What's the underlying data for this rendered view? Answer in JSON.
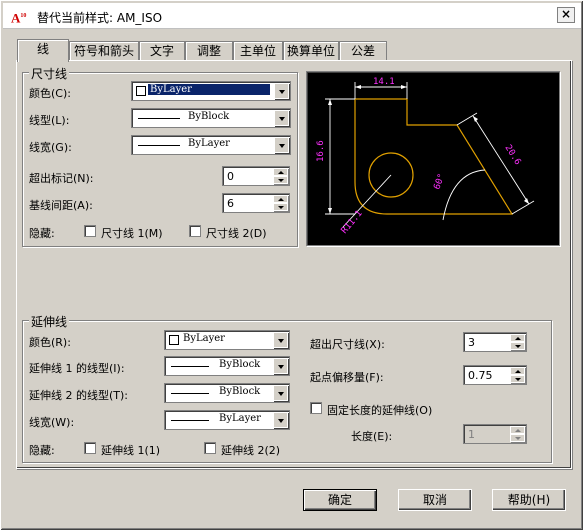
{
  "window": {
    "title": "替代当前样式: AM_ISO",
    "close_label": "×"
  },
  "tabs": [
    {
      "label": "线"
    },
    {
      "label": "符号和箭头"
    },
    {
      "label": "文字"
    },
    {
      "label": "调整"
    },
    {
      "label": "主单位"
    },
    {
      "label": "换算单位"
    },
    {
      "label": "公差"
    }
  ],
  "dim_lines": {
    "legend": "尺寸线",
    "color_label": "颜色(C):",
    "color_value": "ByLayer",
    "linetype_label": "线型(L):",
    "linetype_value": "ByBlock",
    "lineweight_label": "线宽(G):",
    "lineweight_value": "ByLayer",
    "extend_label": "超出标记(N):",
    "extend_value": "0",
    "baseline_label": "基线间距(A):",
    "baseline_value": "6",
    "suppress_label": "隐藏:",
    "suppress1_label": "尺寸线 1(M)",
    "suppress2_label": "尺寸线 2(D)"
  },
  "preview": {
    "dims": [
      "14.1",
      "16.6",
      "20.6",
      "R11.1",
      "60°"
    ]
  },
  "ext_lines": {
    "legend": "延伸线",
    "color_label": "颜色(R):",
    "color_value": "ByLayer",
    "lt1_label": "延伸线 1 的线型(I):",
    "lt1_value": "ByBlock",
    "lt2_label": "延伸线 2 的线型(T):",
    "lt2_value": "ByBlock",
    "lw_label": "线宽(W):",
    "lw_value": "ByLayer",
    "suppress_label": "隐藏:",
    "suppress1_label": "延伸线 1(1)",
    "suppress2_label": "延伸线 2(2)",
    "beyond_label": "超出尺寸线(X):",
    "beyond_value": "3",
    "offset_label": "起点偏移量(F):",
    "offset_value": "0.75",
    "fixed_label": "固定长度的延伸线(O)",
    "length_label": "长度(E):",
    "length_value": "1"
  },
  "buttons": {
    "ok": "确定",
    "cancel": "取消",
    "help": "帮助(H)"
  },
  "colors": {
    "preview_bg": "#000000",
    "geom": "#e0a000",
    "dim": "#ffffff",
    "text": "#ff30ff"
  }
}
